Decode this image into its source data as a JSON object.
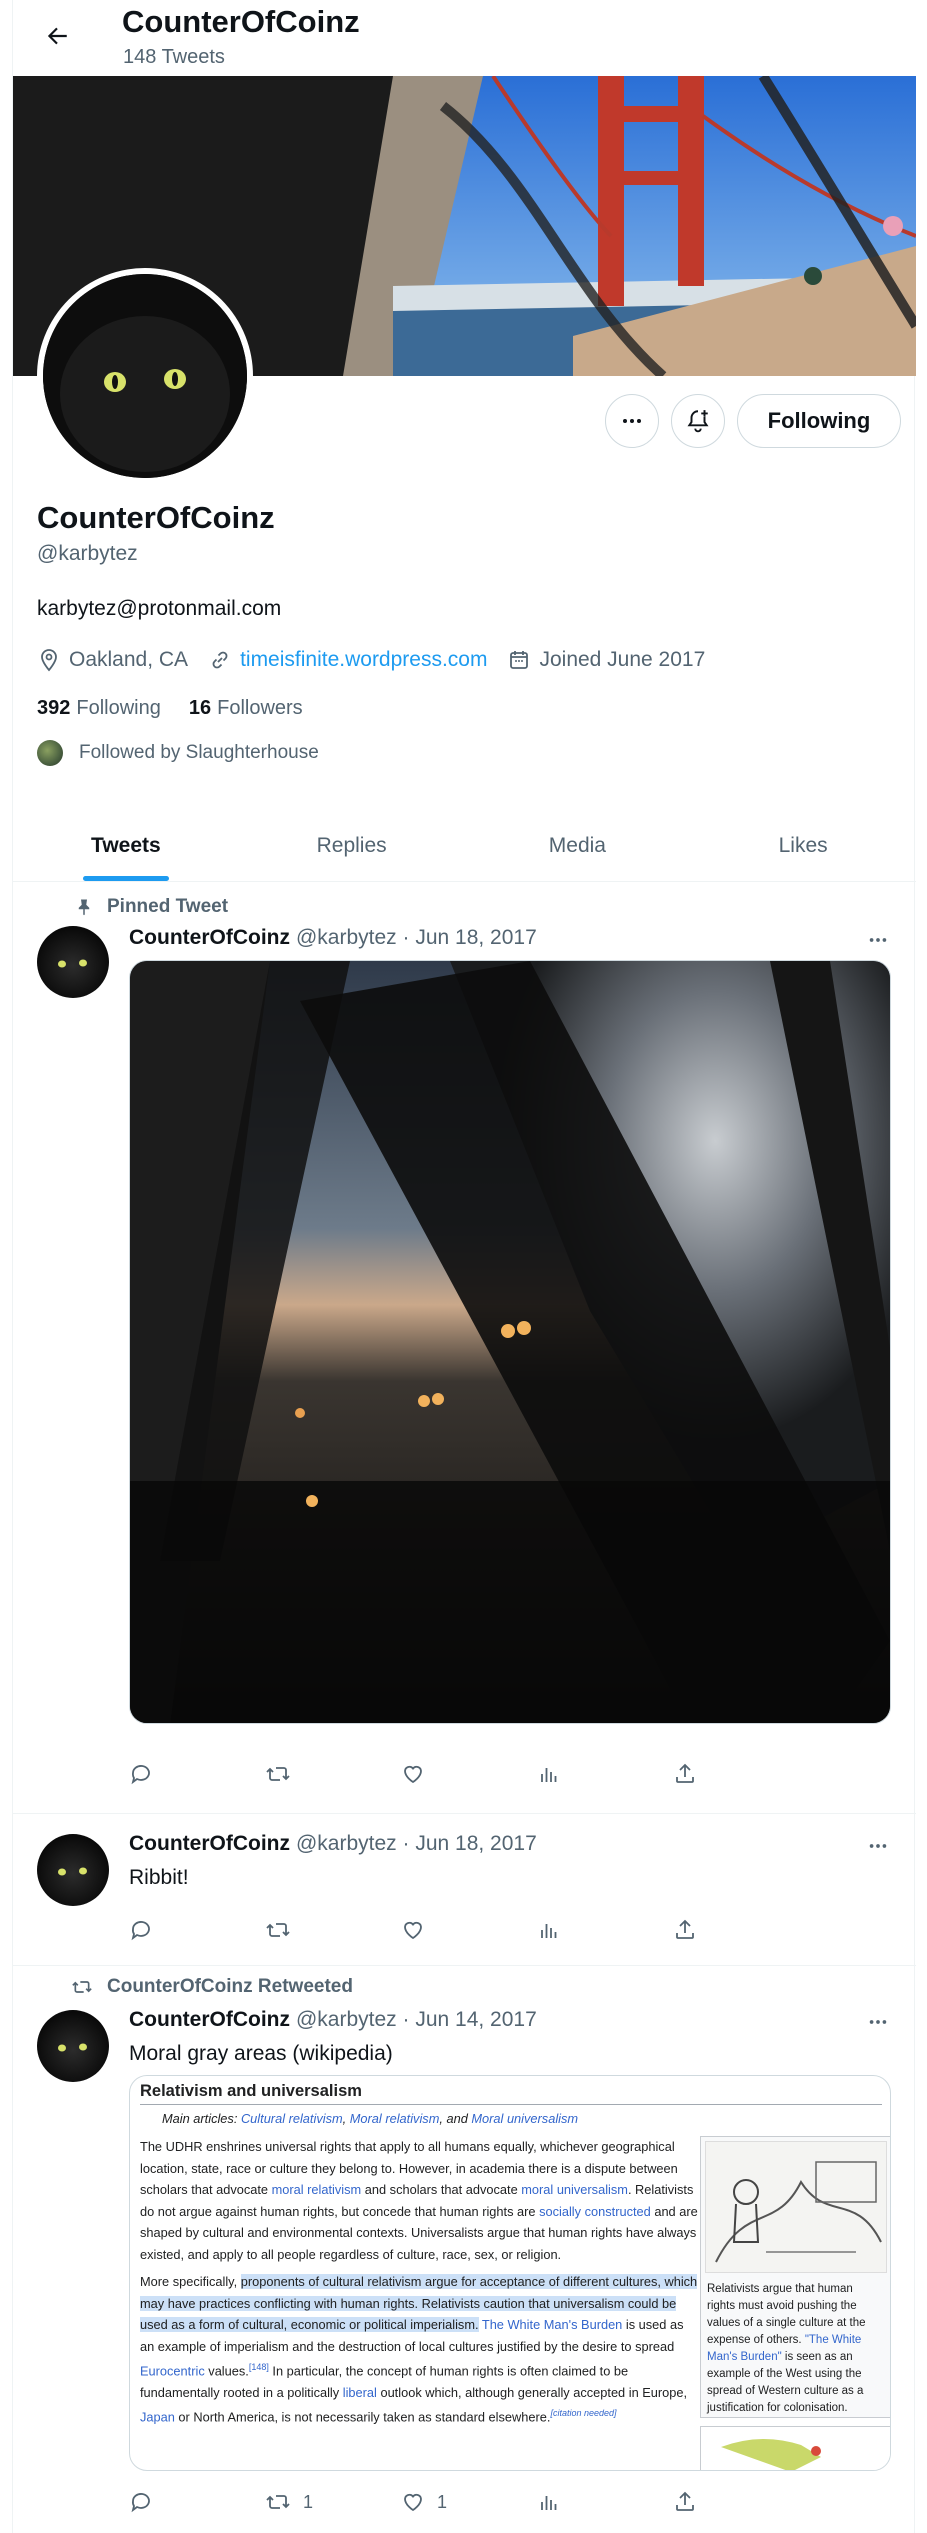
{
  "topbar": {
    "title": "CounterOfCoinz",
    "subtitle": "148 Tweets"
  },
  "profile": {
    "name": "CounterOfCoinz",
    "handle": "@karbytez",
    "bio": "karbytez@protonmail.com",
    "location": "Oakland, CA",
    "website": "timeisfinite.wordpress.com",
    "joined": "Joined June 2017",
    "following_count": "392",
    "following_label": "Following",
    "followers_count": "16",
    "followers_label": "Followers",
    "followed_by": "Followed by Slaughterhouse",
    "following_button": "Following"
  },
  "tabs": [
    "Tweets",
    "Replies",
    "Media",
    "Likes"
  ],
  "tweets": [
    {
      "context": "Pinned Tweet",
      "name": "CounterOfCoinz",
      "meta": "@karbytez · Jun 18, 2017"
    },
    {
      "name": "CounterOfCoinz",
      "meta": "@karbytez · Jun 18, 2017",
      "text": "Ribbit!"
    },
    {
      "context": "CounterOfCoinz Retweeted",
      "name": "CounterOfCoinz",
      "meta": "@karbytez · Jun 14, 2017",
      "text": "Moral gray areas (wikipedia)",
      "retweets": "1",
      "likes": "1"
    }
  ],
  "wiki": {
    "heading": "Relativism and universalism",
    "main_prefix": "Main articles: ",
    "main_links": [
      "Cultural relativism",
      "Moral relativism",
      "Moral universalism"
    ],
    "main_sep1": ", ",
    "main_sep2": ", and ",
    "p1_a": "The UDHR enshrines universal rights that apply to all humans equally, whichever geographical location, state, race or culture they belong to. However, in academia there is a dispute between scholars that advocate ",
    "p1_l1": "moral relativism",
    "p1_b": " and scholars that advocate ",
    "p1_l2": "moral universalism",
    "p1_c": ". Relativists do not argue against human rights, but concede that human rights are ",
    "p1_l3": "socially constructed",
    "p1_d": " and are shaped by cultural and environmental contexts. Universalists argue that human rights have always existed, and apply to all people regardless of culture, race, sex, or religion.",
    "p2_a": "More specifically, ",
    "p2_hl": "proponents of cultural relativism argue for acceptance of different cultures, which may have practices conflicting with human rights. Relativists caution that universalism could be used as a form of cultural, economic or political imperialism.",
    "p2_b": " ",
    "p2_l1": "The White Man's Burden",
    "p2_c": " is used as an example of imperialism and the destruction of local cultures justified by the desire to spread ",
    "p2_l2": "Eurocentric",
    "p2_d": " values.",
    "p2_ref": "[148]",
    "p2_e": " In particular, the concept of human rights is often claimed to be fundamentally rooted in a politically ",
    "p2_l3": "liberal",
    "p2_f": " outlook which, although generally accepted in Europe, ",
    "p2_l4": "Japan",
    "p2_g": " or North America, is not necessarily taken as standard elsewhere.",
    "p2_cite": "[citation needed]",
    "cap_a": "Relativists argue that human rights must avoid pushing the values of a single culture at the expense of others. ",
    "cap_l": "\"The White Man's Burden\"",
    "cap_b": " is seen as an example of the West using the spread of Western culture as a justification for colonisation."
  },
  "icons": {
    "back": "arrow-left-icon",
    "more": "more-icon",
    "notify": "bell-plus-icon",
    "location": "location-icon",
    "link": "link-icon",
    "calendar": "calendar-icon",
    "pin": "pin-icon",
    "retweet": "retweet-icon",
    "reply": "reply-icon",
    "like": "heart-icon",
    "views": "views-icon",
    "share": "share-icon"
  },
  "colors": {
    "accent": "#1d9bf0",
    "text": "#0f1419",
    "muted": "#536471",
    "highlight": "#cce0f7"
  }
}
